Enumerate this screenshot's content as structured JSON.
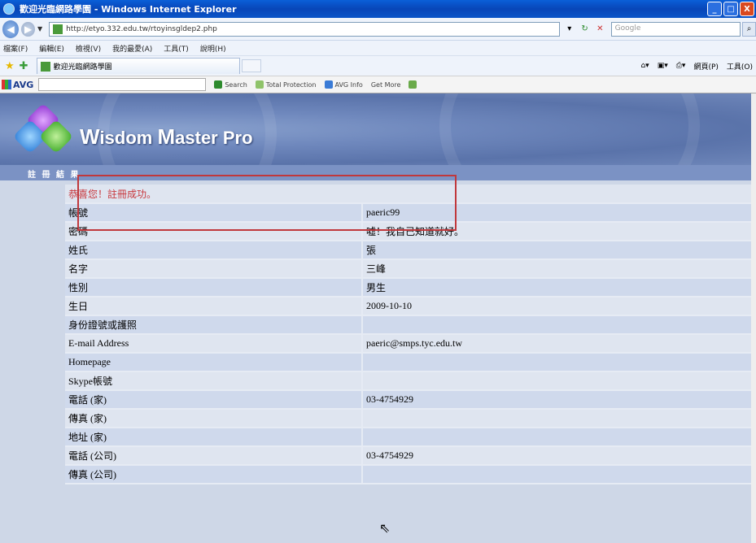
{
  "window": {
    "title": "歡迎光臨網路學園 - Windows Internet Explorer",
    "controls": [
      "_",
      "□",
      "X"
    ]
  },
  "address_bar": {
    "url": "http://etyo.332.edu.tw/rtoyinsgldep2.php",
    "search_placeholder": "Google"
  },
  "menu": [
    "檔案(F)",
    "編輯(E)",
    "檢視(V)",
    "我的最愛(A)",
    "工具(T)",
    "說明(H)"
  ],
  "tab": {
    "label": "歡迎光臨網路學園"
  },
  "command_bar": {
    "page_label": "網頁(P)",
    "tools_label": "工具(O)"
  },
  "avg_toolbar": {
    "brand": "AVG",
    "search_label": "Search",
    "total_protection": "Total Protection",
    "avg_info": "AVG Info",
    "get_more": "Get More"
  },
  "site": {
    "brand_w": "W",
    "brand_isdom": "isdom",
    "brand_m": "M",
    "brand_aster": "aster Pro",
    "nav_label": "註 冊 結 果"
  },
  "status_message": "恭喜您！註冊成功。",
  "rows": [
    {
      "label": "帳號",
      "value": "paeric99"
    },
    {
      "label": "密碼",
      "value": "嘘！我自己知道就好。"
    },
    {
      "label": "姓氏",
      "value": "張"
    },
    {
      "label": "名字",
      "value": "三峰"
    },
    {
      "label": "性別",
      "value": "男生"
    },
    {
      "label": "生日",
      "value": "2009-10-10"
    },
    {
      "label": "身份證號或護照",
      "value": ""
    },
    {
      "label": "E-mail Address",
      "value": "paeric@smps.tyc.edu.tw"
    },
    {
      "label": "Homepage",
      "value": ""
    },
    {
      "label": "Skype帳號",
      "value": ""
    },
    {
      "label": "電話 (家)",
      "value": "03-4754929"
    },
    {
      "label": "傳真 (家)",
      "value": ""
    },
    {
      "label": "地址 (家)",
      "value": ""
    },
    {
      "label": "電話 (公司)",
      "value": "03-4754929"
    },
    {
      "label": "傳真 (公司)",
      "value": ""
    }
  ]
}
